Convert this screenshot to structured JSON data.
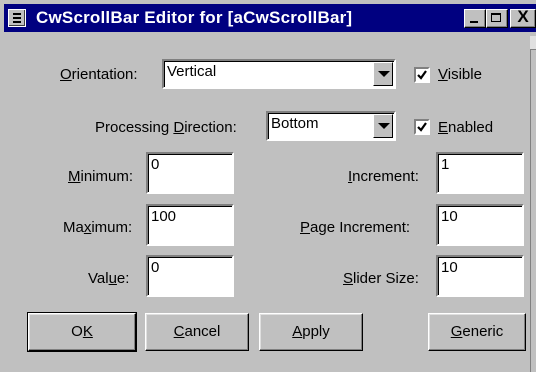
{
  "window": {
    "title": "CwScrollBar Editor for [aCwScrollBar]",
    "minimize_icon": "minimize-icon",
    "maximize_icon": "maximize-icon",
    "close_label": "X"
  },
  "orientation": {
    "label_pre": "",
    "label_key": "O",
    "label_post": "rientation:",
    "value": "Vertical"
  },
  "visible": {
    "label_key": "V",
    "label_post": "isible",
    "checked": true
  },
  "processing": {
    "label_pre": "Processing ",
    "label_key": "D",
    "label_post": "irection:",
    "value": "Bottom"
  },
  "enabled": {
    "label_key": "E",
    "label_post": "nabled",
    "checked": true
  },
  "minimum": {
    "label_key": "M",
    "label_post": "inimum:",
    "value": "0"
  },
  "maximum": {
    "label_pre": "Ma",
    "label_key": "x",
    "label_post": "imum:",
    "value": "100"
  },
  "value_field": {
    "label_pre": "Val",
    "label_key": "u",
    "label_post": "e:",
    "value": "0"
  },
  "increment": {
    "label_key": "I",
    "label_post": "ncrement:",
    "value": "1"
  },
  "page_increment": {
    "label_key": "P",
    "label_post": "age Increment:",
    "value": "10"
  },
  "slider_size": {
    "label_key": "S",
    "label_post": "lider Size:",
    "value": "10"
  },
  "buttons": {
    "ok_pre": "O",
    "ok_key": "K",
    "cancel_key": "C",
    "cancel_post": "ancel",
    "apply_key": "A",
    "apply_post": "pply",
    "generic_key": "G",
    "generic_post": "eneric"
  }
}
